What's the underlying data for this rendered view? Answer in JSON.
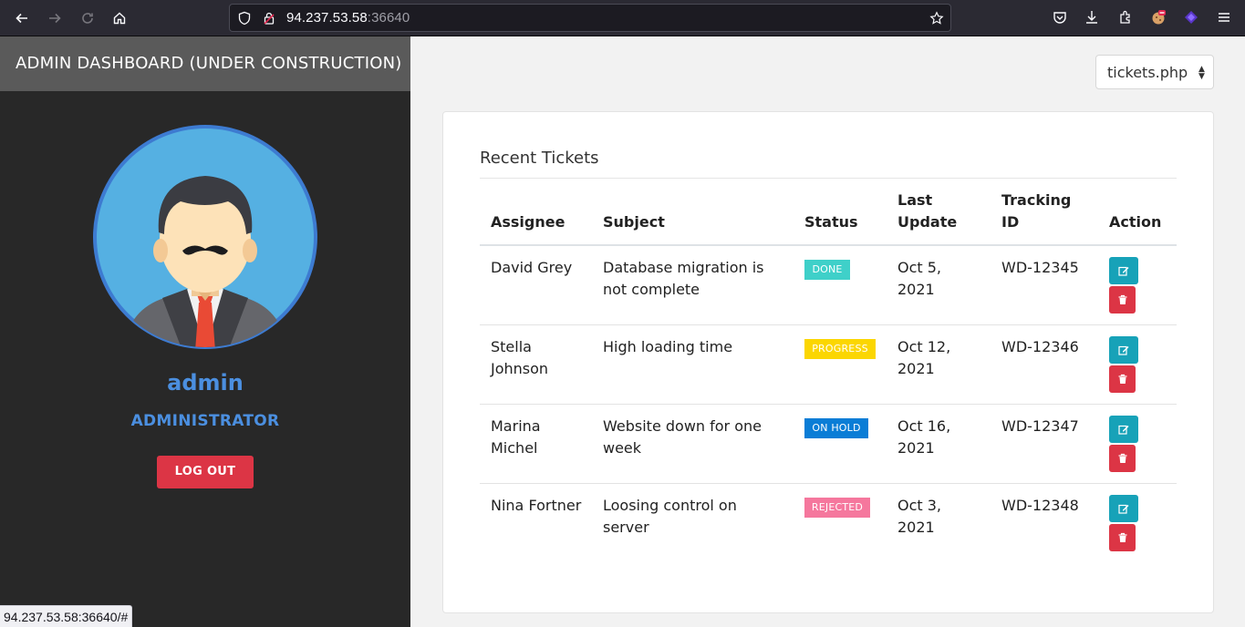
{
  "browser": {
    "url_host": "94.237.53.58",
    "url_port": ":36640",
    "status_url": "94.237.53.58:36640/#"
  },
  "sidebar": {
    "title": "ADMIN DASHBOARD (UNDER CONSTRUCTION)",
    "user_name": "admin",
    "user_role": "ADMINISTRATOR",
    "logout_label": "LOG OUT"
  },
  "page_selector": {
    "selected": "tickets.php"
  },
  "tickets": {
    "title": "Recent Tickets",
    "columns": {
      "assignee": "Assignee",
      "subject": "Subject",
      "status": "Status",
      "last_update_1": "Last",
      "last_update_2": "Update",
      "tracking_1": "Tracking",
      "tracking_2": "ID",
      "action": "Action"
    },
    "rows": [
      {
        "assignee_1": "David Grey",
        "assignee_2": "",
        "subject_1": "Database migration is",
        "subject_2": "not complete",
        "status": "DONE",
        "status_color": "#3fd0c9",
        "date_1": "Oct 5,",
        "date_2": "2021",
        "tracking_id": "WD-12345"
      },
      {
        "assignee_1": "Stella",
        "assignee_2": "Johnson",
        "subject_1": "High loading time",
        "subject_2": "",
        "status": "PROGRESS",
        "status_color": "#fbd602",
        "date_1": "Oct 12,",
        "date_2": "2021",
        "tracking_id": "WD-12346"
      },
      {
        "assignee_1": "Marina",
        "assignee_2": "Michel",
        "subject_1": "Website down for one",
        "subject_2": "week",
        "status": "ON HOLD",
        "status_color": "#0a7dd6",
        "date_1": "Oct 16,",
        "date_2": "2021",
        "tracking_id": "WD-12347"
      },
      {
        "assignee_1": "Nina Fortner",
        "assignee_2": "",
        "subject_1": "Loosing control on",
        "subject_2": "server",
        "status": "REJECTED",
        "status_color": "#f5779d",
        "date_1": "Oct 3,",
        "date_2": "2021",
        "tracking_id": "WD-12348"
      }
    ]
  },
  "icons": {
    "back": "arrow-left-icon",
    "forward": "arrow-right-icon",
    "reload": "reload-icon",
    "home": "home-icon",
    "shield": "shield-icon",
    "lock": "lock-icon",
    "bookmark": "star-icon",
    "pocket": "pocket-icon",
    "downloads": "download-icon",
    "extensions": "puzzle-icon",
    "menu": "hamburger-menu-icon",
    "edit": "edit-icon",
    "delete": "trash-icon"
  }
}
